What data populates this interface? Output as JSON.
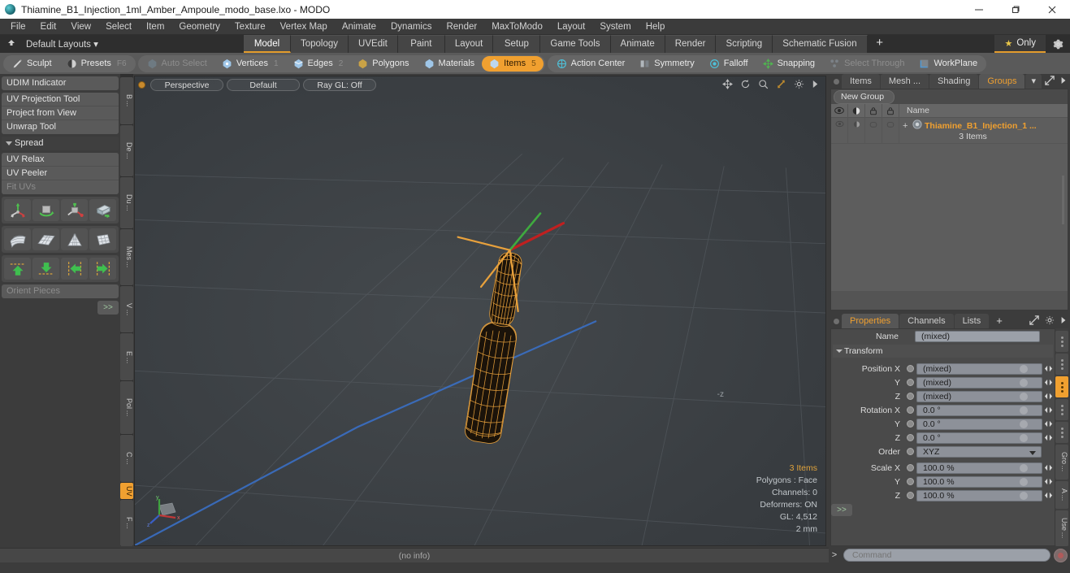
{
  "window": {
    "title": "Thiamine_B1_Injection_1ml_Amber_Ampoule_modo_base.lxo - MODO",
    "minimize": "—",
    "maximize": "❐",
    "close": "✕"
  },
  "menubar": [
    "File",
    "Edit",
    "View",
    "Select",
    "Item",
    "Geometry",
    "Texture",
    "Vertex Map",
    "Animate",
    "Dynamics",
    "Render",
    "MaxToModo",
    "Layout",
    "System",
    "Help"
  ],
  "layoutbar": {
    "default_layouts": "Default Layouts ▾",
    "tabs": [
      {
        "label": "Model",
        "active": true
      },
      {
        "label": "Topology",
        "active": false
      },
      {
        "label": "UVEdit",
        "active": false
      },
      {
        "label": "Paint",
        "active": false
      },
      {
        "label": "Layout",
        "active": false
      },
      {
        "label": "Setup",
        "active": false
      },
      {
        "label": "Game Tools",
        "active": false
      },
      {
        "label": "Animate",
        "active": false
      },
      {
        "label": "Render",
        "active": false
      },
      {
        "label": "Scripting",
        "active": false
      },
      {
        "label": "Schematic Fusion",
        "active": false
      }
    ],
    "add_tab": "+",
    "only_label": "Only"
  },
  "modebar": {
    "sculpt": "Sculpt",
    "presets": "Presets",
    "presets_key": "F6",
    "selection_modes": [
      {
        "label": "Auto Select",
        "num": "",
        "state": "dim"
      },
      {
        "label": "Vertices",
        "num": "1",
        "state": "normal"
      },
      {
        "label": "Edges",
        "num": "2",
        "state": "normal"
      },
      {
        "label": "Polygons",
        "num": "",
        "state": "normal"
      },
      {
        "label": "Materials",
        "num": "",
        "state": "normal"
      },
      {
        "label": "Items",
        "num": "5",
        "state": "active"
      }
    ],
    "tools": [
      {
        "label": "Action Center",
        "state": "normal"
      },
      {
        "label": "Symmetry",
        "state": "normal"
      },
      {
        "label": "Falloff",
        "state": "normal"
      },
      {
        "label": "Snapping",
        "state": "normal"
      },
      {
        "label": "Select Through",
        "state": "dim"
      },
      {
        "label": "WorkPlane",
        "state": "normal"
      }
    ]
  },
  "leftpanel": {
    "udim": "UDIM Indicator",
    "uv_tools": [
      "UV Projection Tool",
      "Project from View",
      "Unwrap Tool"
    ],
    "spread_header": "Spread",
    "relax_tools": [
      {
        "label": "UV Relax",
        "dim": false
      },
      {
        "label": "UV Peeler",
        "dim": false
      },
      {
        "label": "Fit UVs",
        "dim": true
      }
    ],
    "orient_pieces": "Orient Pieces",
    "more_button": ">>",
    "vertical_tabs": [
      {
        "label": "B ...",
        "active": false
      },
      {
        "label": "De ...",
        "active": false
      },
      {
        "label": "Du ...",
        "active": false
      },
      {
        "label": "Mes ...",
        "active": false
      },
      {
        "label": "V ...",
        "active": false
      },
      {
        "label": "E ...",
        "active": false
      },
      {
        "label": "Pol ...",
        "active": false
      },
      {
        "label": "C ...",
        "active": false
      },
      {
        "label": "UV",
        "active": true
      },
      {
        "label": "F ...",
        "active": false
      }
    ]
  },
  "viewport": {
    "view_mode": "Perspective",
    "shading": "Default",
    "raygl": "Ray GL: Off",
    "z_label": "-z",
    "stats": {
      "items": "3 Items",
      "polygons": "Polygons : Face",
      "channels": "Channels: 0",
      "deformers": "Deformers: ON",
      "gl": "GL: 4,512",
      "size": "2 mm"
    },
    "info": "(no info)"
  },
  "rightpanel": {
    "top_tabs": [
      {
        "label": "Items",
        "active": false
      },
      {
        "label": "Mesh ...",
        "active": false
      },
      {
        "label": "Shading",
        "active": false
      },
      {
        "label": "Groups",
        "active": true
      }
    ],
    "new_group": "New Group",
    "tree_header": "Name",
    "group_item": {
      "name": "Thiamine_B1_Injection_1 ...",
      "sub": "3 Items",
      "expander": "+"
    },
    "bottom_tabs": [
      {
        "label": "Properties",
        "active": true
      },
      {
        "label": "Channels",
        "active": false
      },
      {
        "label": "Lists",
        "active": false
      },
      {
        "label": "+",
        "active": false
      }
    ],
    "properties": {
      "name_label": "Name",
      "name_value": "(mixed)",
      "transform_header": "Transform",
      "rows": [
        {
          "label": "Position X",
          "value": "(mixed)"
        },
        {
          "label": "Y",
          "value": "(mixed)"
        },
        {
          "label": "Z",
          "value": "(mixed)"
        },
        {
          "label": "Rotation X",
          "value": "0.0 °"
        },
        {
          "label": "Y",
          "value": "0.0 °"
        },
        {
          "label": "Z",
          "value": "0.0 °"
        }
      ],
      "order_label": "Order",
      "order_value": "XYZ",
      "scale_rows": [
        {
          "label": "Scale X",
          "value": "100.0 %"
        },
        {
          "label": "Y",
          "value": "100.0 %"
        },
        {
          "label": "Z",
          "value": "100.0 %"
        }
      ],
      "more_button": ">>"
    },
    "vertical_tabs": [
      {
        "label": "Gro ...",
        "active": false
      },
      {
        "label": "A ...",
        "active": false
      },
      {
        "label": "Use ...",
        "active": false
      }
    ]
  },
  "bottombar": {
    "command_arrow": ">",
    "command_placeholder": "Command"
  },
  "colors": {
    "accent": "#f0a030",
    "wireframe": "#e8a13c",
    "axis_x": "#c02020",
    "axis_y": "#30a030",
    "axis_z": "#2050c0"
  }
}
